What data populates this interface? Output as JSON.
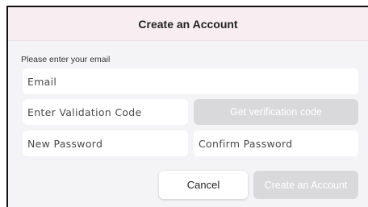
{
  "dialog": {
    "title": "Create an Account",
    "prompt": "Please enter your email"
  },
  "fields": {
    "email_placeholder": "Email",
    "code_placeholder": "Enter Validation Code",
    "new_password_placeholder": "New Password",
    "confirm_password_placeholder": "Confirm Password"
  },
  "buttons": {
    "get_code": "Get verification code",
    "cancel": "Cancel",
    "create": "Create an Account"
  },
  "colors": {
    "header_bg": "#f8eef1",
    "dialog_bg": "#f4f4f6",
    "disabled_button_bg": "#d9d9dc"
  }
}
